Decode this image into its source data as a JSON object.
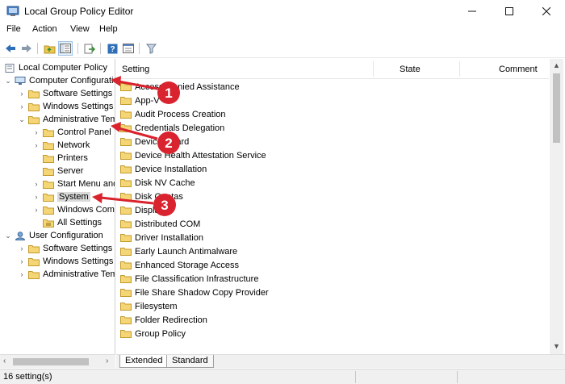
{
  "window": {
    "title": "Local Group Policy Editor",
    "accent": "#d9232e"
  },
  "menu": [
    "File",
    "Action",
    "View",
    "Help"
  ],
  "toolbar": [
    "back-icon",
    "forward-icon",
    "up-folder-icon",
    "show-hide-tree-icon",
    "export-list-icon",
    "help-icon",
    "properties-icon",
    "filter-icon"
  ],
  "tree": [
    {
      "label": "Local Computer Policy"
    },
    {
      "label": "Computer Configuration"
    },
    {
      "label": "Software Settings"
    },
    {
      "label": "Windows Settings"
    },
    {
      "label": "Administrative Templates"
    },
    {
      "label": "Control Panel"
    },
    {
      "label": "Network"
    },
    {
      "label": "Printers"
    },
    {
      "label": "Server"
    },
    {
      "label": "Start Menu and Taskbar"
    },
    {
      "label": "System"
    },
    {
      "label": "Windows Components"
    },
    {
      "label": "All Settings"
    },
    {
      "label": "User Configuration"
    },
    {
      "label": "Software Settings"
    },
    {
      "label": "Windows Settings"
    },
    {
      "label": "Administrative Templates"
    }
  ],
  "columns": {
    "setting": "Setting",
    "state": "State",
    "comment": "Comment"
  },
  "settings": [
    "Access-Denied Assistance",
    "App-V",
    "Audit Process Creation",
    "Credentials Delegation",
    "Device Guard",
    "Device Health Attestation Service",
    "Device Installation",
    "Disk NV Cache",
    "Disk Quotas",
    "Display",
    "Distributed COM",
    "Driver Installation",
    "Early Launch Antimalware",
    "Enhanced Storage Access",
    "File Classification Infrastructure",
    "File Share Shadow Copy Provider",
    "Filesystem",
    "Folder Redirection",
    "Group Policy"
  ],
  "tabs": {
    "extended": "Extended",
    "standard": "Standard"
  },
  "status": "16 setting(s)",
  "annotations": [
    "1",
    "2",
    "3"
  ]
}
